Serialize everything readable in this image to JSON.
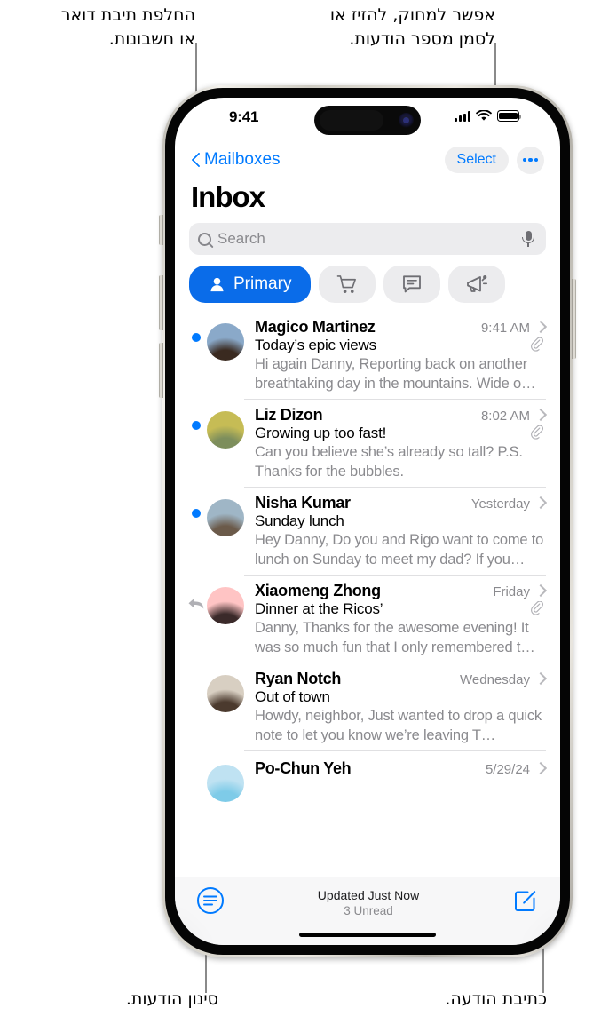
{
  "annotations": [
    {
      "id": "mailboxes",
      "text": "החלפת תיבת דואר\nאו חשבונות."
    },
    {
      "id": "select",
      "text": "אפשר למחוק, להזיז או\nלסמן מספר הודעות."
    },
    {
      "id": "filter",
      "text": "סינון הודעות."
    },
    {
      "id": "compose",
      "text": "כתיבת הודעה."
    }
  ],
  "status_bar": {
    "time": "9:41",
    "cellular_icon": "signal-bars-icon",
    "wifi_icon": "wifi-icon",
    "battery_icon": "battery-icon"
  },
  "nav_bar": {
    "back_label": "Mailboxes",
    "back_icon": "chevron-left-icon",
    "select_label": "Select",
    "more_icon": "ellipsis-icon"
  },
  "page_title": "Inbox",
  "search": {
    "placeholder": "Search",
    "search_icon": "search-icon",
    "dictate_icon": "microphone-icon"
  },
  "chips": [
    {
      "label": "Primary",
      "icon": "person-icon",
      "active": true,
      "accent": "#0a6ce9"
    },
    {
      "label": "",
      "icon": "cart-icon",
      "active": false
    },
    {
      "label": "",
      "icon": "chat-bubble-icon",
      "active": false
    },
    {
      "label": "",
      "icon": "megaphone-icon",
      "active": false
    }
  ],
  "emails": [
    {
      "sender": "Magico Martinez",
      "time": "9:41 AM",
      "subject": "Today’s epic views",
      "preview": "Hi again Danny, Reporting back on another breathtaking day in the mountains. Wide o…",
      "unread": true,
      "replied": false,
      "attachment": true,
      "avatar_colors": [
        "#8aa9c9",
        "#3a2a20"
      ]
    },
    {
      "sender": "Liz Dizon",
      "time": "8:02 AM",
      "subject": "Growing up too fast!",
      "preview": "Can you believe she’s already so tall? P.S. Thanks for the bubbles.",
      "unread": true,
      "replied": false,
      "attachment": true,
      "avatar_colors": [
        "#c6bc55",
        "#7d8e5c"
      ]
    },
    {
      "sender": "Nisha Kumar",
      "time": "Yesterday",
      "subject": "Sunday lunch",
      "preview": "Hey Danny, Do you and Rigo want to come to lunch on Sunday to meet my dad? If you…",
      "unread": true,
      "replied": false,
      "attachment": false,
      "avatar_colors": [
        "#9fb6c6",
        "#6b5a4a"
      ]
    },
    {
      "sender": "Xiaomeng Zhong",
      "time": "Friday",
      "subject": "Dinner at the Ricos’",
      "preview": "Danny, Thanks for the awesome evening! It was so much fun that I only remembered t…",
      "unread": false,
      "replied": true,
      "attachment": true,
      "avatar_colors": [
        "#ffc4c4",
        "#3b2a2a"
      ]
    },
    {
      "sender": "Ryan Notch",
      "time": "Wednesday",
      "subject": "Out of town",
      "preview": "Howdy, neighbor, Just wanted to drop a quick note to let you know we’re leaving T…",
      "unread": false,
      "replied": false,
      "attachment": false,
      "avatar_colors": [
        "#d8cfc2",
        "#4b3a2e"
      ]
    },
    {
      "sender": "Po-Chun Yeh",
      "time": "5/29/24",
      "subject": "",
      "preview": "",
      "unread": false,
      "replied": false,
      "attachment": false,
      "avatar_colors": [
        "#bfe2f2",
        "#7ecbe8"
      ]
    }
  ],
  "toolbar": {
    "filter_icon": "filter-icon",
    "updated_text": "Updated Just Now",
    "unread_text": "3 Unread",
    "compose_icon": "compose-icon"
  }
}
